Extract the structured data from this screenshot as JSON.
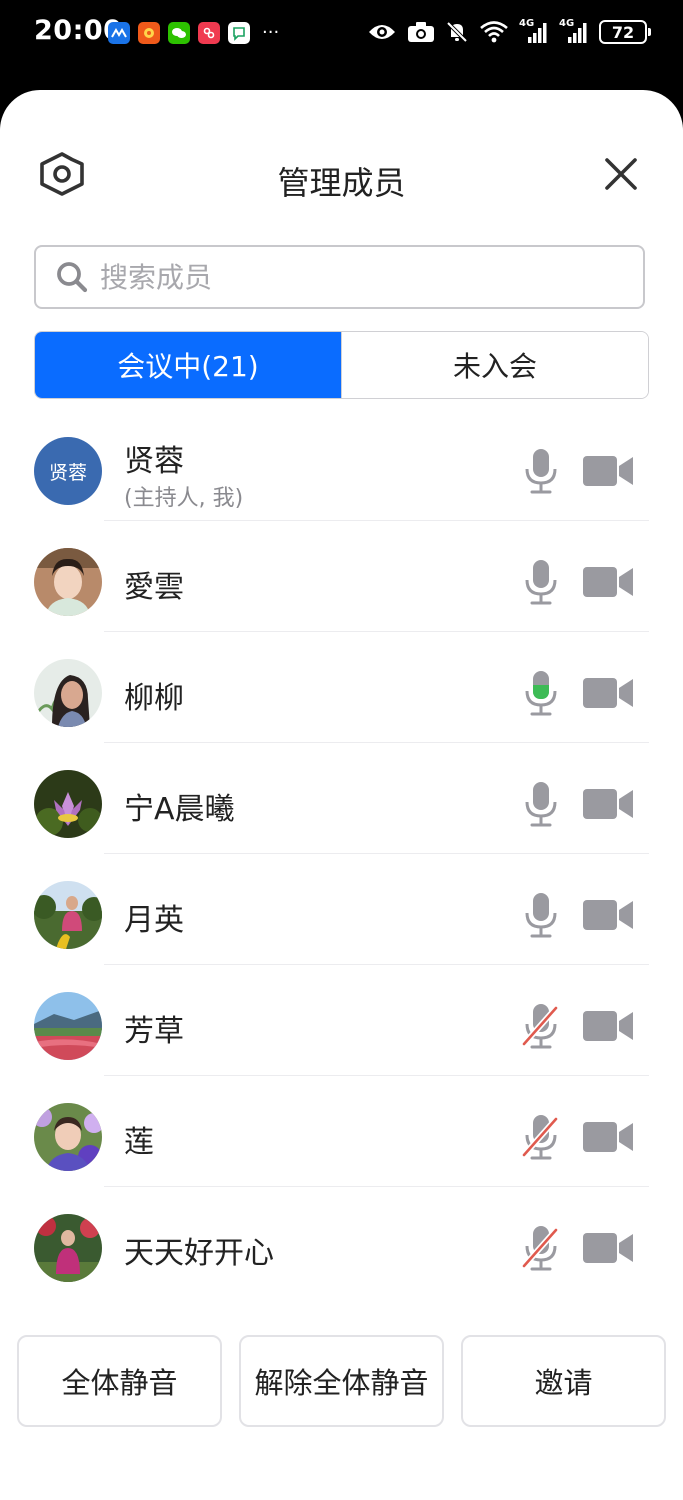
{
  "status_bar": {
    "time": "20:00",
    "more": "···",
    "battery": "72",
    "signal_1": "4G",
    "signal_2": "4G"
  },
  "header": {
    "title": "管理成员"
  },
  "search": {
    "placeholder": "搜索成员",
    "value": ""
  },
  "tabs": [
    {
      "label": "会议中(21)",
      "active": true
    },
    {
      "label": "未入会",
      "active": false
    }
  ],
  "members": [
    {
      "name": "贤蓉",
      "role": "(主持人, 我)",
      "avatar_text": "贤蓉",
      "mic": "on",
      "camera": "off"
    },
    {
      "name": "愛雲",
      "mic": "on",
      "camera": "off"
    },
    {
      "name": "柳柳",
      "mic": "speaking",
      "camera": "off"
    },
    {
      "name": "宁A晨曦",
      "mic": "on",
      "camera": "off"
    },
    {
      "name": "月英",
      "mic": "on",
      "camera": "off"
    },
    {
      "name": "芳草",
      "mic": "muted",
      "camera": "off"
    },
    {
      "name": "莲",
      "mic": "muted",
      "camera": "off"
    },
    {
      "name": "天天好开心",
      "mic": "muted",
      "camera": "off"
    }
  ],
  "actions": {
    "mute_all": "全体静音",
    "unmute_all": "解除全体静音",
    "invite": "邀请"
  },
  "colors": {
    "accent": "#0a6cff",
    "muted_slash": "#e05a4e",
    "speaking": "#3dbb55",
    "icon_gray": "#9a9aa0"
  }
}
